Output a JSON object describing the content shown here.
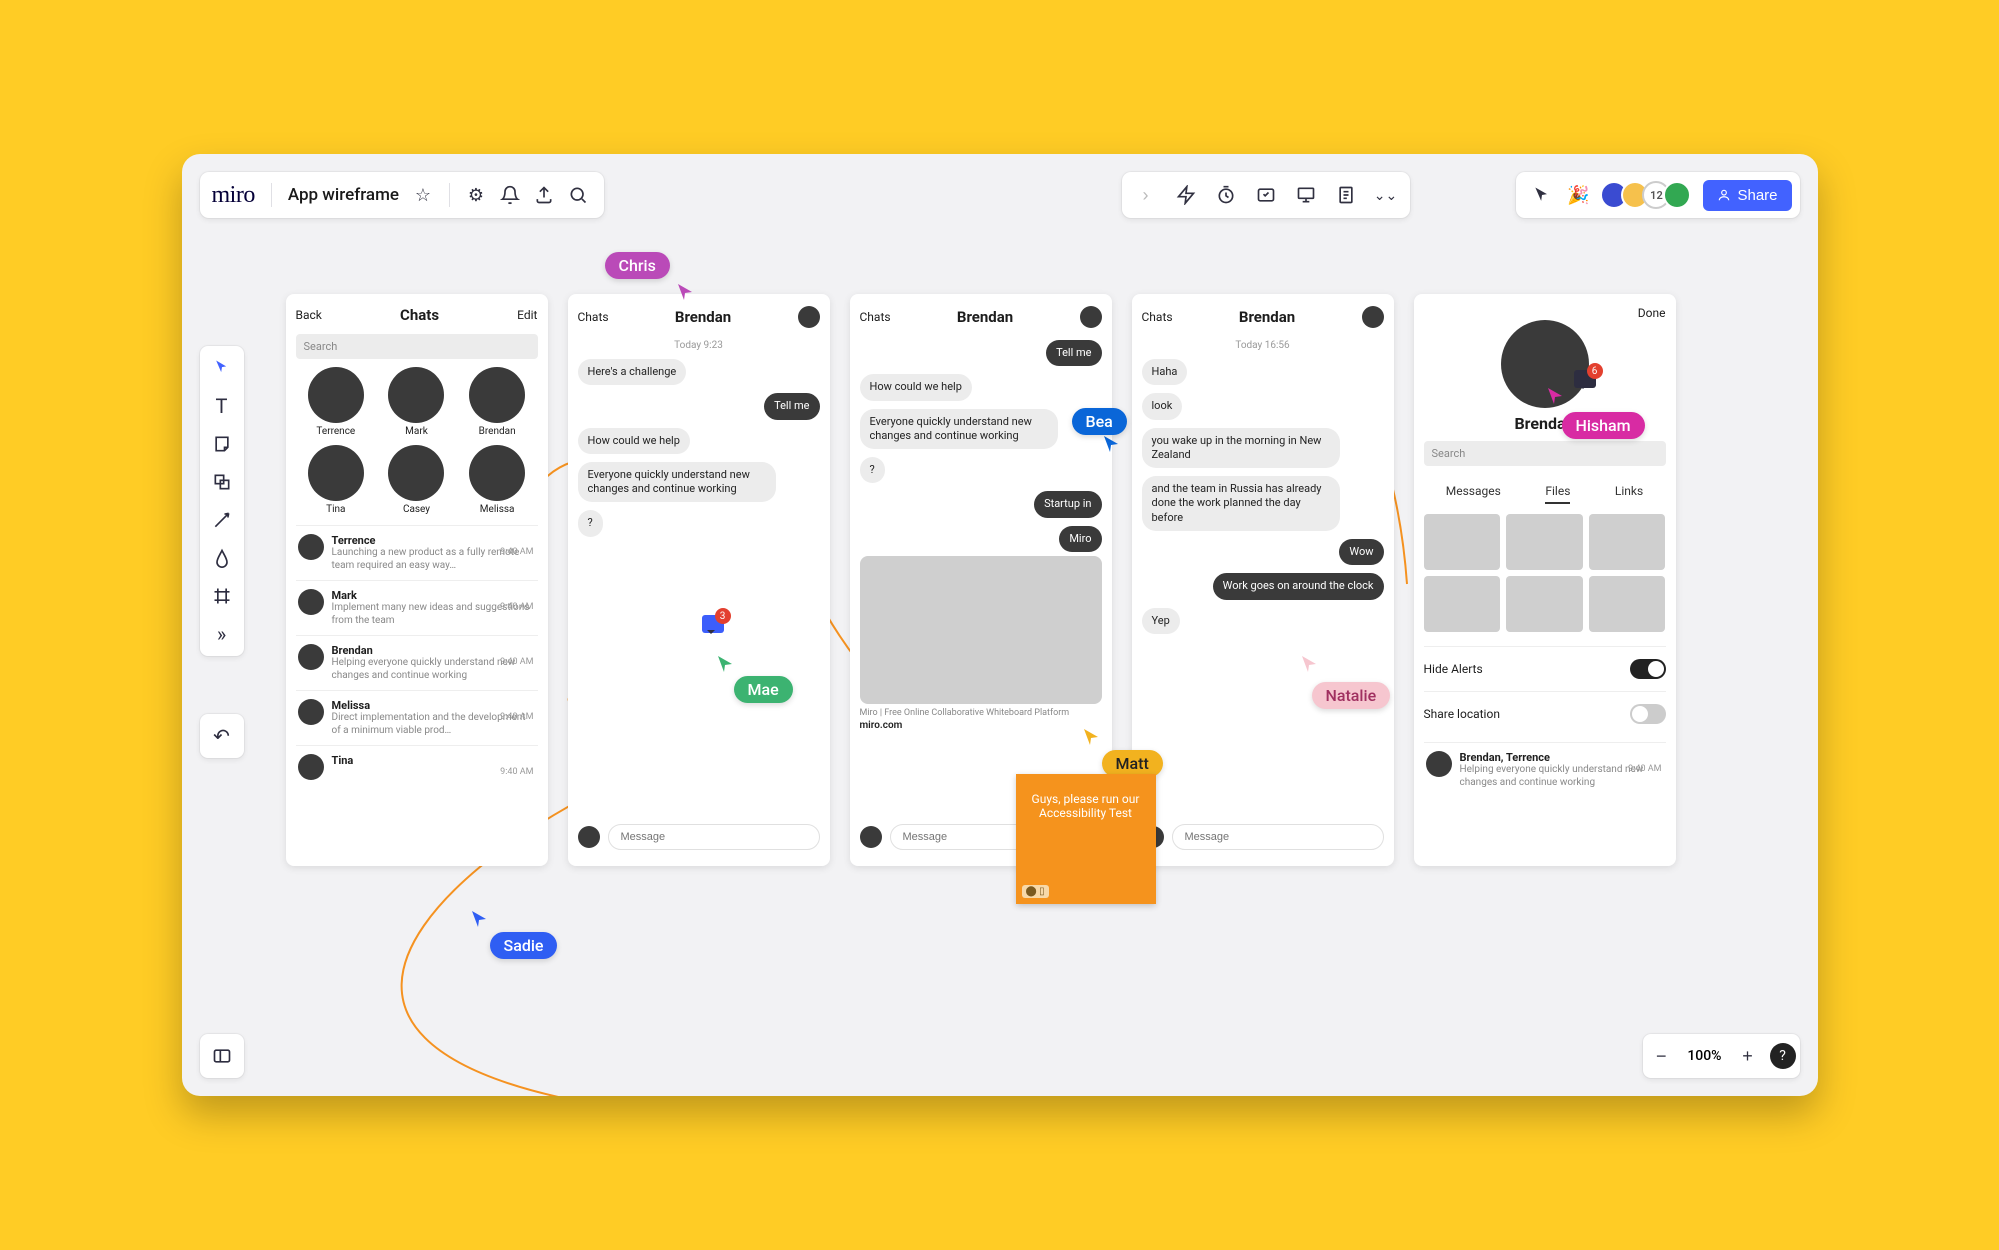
{
  "app": {
    "logo": "miro",
    "board_title": "App wireframe"
  },
  "share": {
    "label": "Share"
  },
  "avatar_count": "12",
  "zoom": {
    "level": "100%"
  },
  "cursors": {
    "chris": "Chris",
    "mae": "Mae",
    "sadie": "Sadie",
    "bea": "Bea",
    "matt": "Matt",
    "natalie": "Natalie",
    "hisham": "Hisham"
  },
  "sticky": {
    "text": "Guys, please run our Accessibility Test"
  },
  "chat_badge": {
    "count": "3"
  },
  "profile_badge": {
    "count": "6"
  },
  "times": {
    "t1": "Today 9:23",
    "t2": "Today 16:56"
  },
  "wf1": {
    "back": "Back",
    "title": "Chats",
    "edit": "Edit",
    "search": "Search",
    "contacts": [
      {
        "name": "Terrence"
      },
      {
        "name": "Mark"
      },
      {
        "name": "Brendan"
      },
      {
        "name": "Tina"
      },
      {
        "name": "Casey"
      },
      {
        "name": "Melissa"
      }
    ],
    "items": [
      {
        "name": "Terrence",
        "time": "9:40 AM",
        "preview": "Launching a new product as a fully remote team required an easy way…"
      },
      {
        "name": "Mark",
        "time": "9:40 AM",
        "preview": "Implement many new ideas and suggestions from the team"
      },
      {
        "name": "Brendan",
        "time": "9:40 AM",
        "preview": "Helping everyone quickly understand new changes and continue working"
      },
      {
        "name": "Melissa",
        "time": "9:40 AM",
        "preview": "Direct implementation and the development of a minimum viable prod…"
      },
      {
        "name": "Tina",
        "time": "9:40 AM",
        "preview": ""
      }
    ]
  },
  "wf2": {
    "back": "Chats",
    "title": "Brendan",
    "m1": "Here's a challenge",
    "r1": "Tell me",
    "m2": "How could we help",
    "m3": "Everyone quickly understand new changes and continue working",
    "m4": "?",
    "compose": "Message"
  },
  "wf3": {
    "back": "Chats",
    "title": "Brendan",
    "r0": "Tell me",
    "m1": "How could we help",
    "m2": "Everyone quickly understand new changes and continue working",
    "m3": "?",
    "r1": "Startup in",
    "r2": "Miro",
    "link_title": "Miro | Free Online Collaborative Whiteboard Platform",
    "link_url": "miro.com",
    "compose": "Message"
  },
  "wf4": {
    "back": "Chats",
    "title": "Brendan",
    "m1": "Haha",
    "m2": "look",
    "m3": "you wake up in the morning in New Zealand",
    "m4": "and the team in Russia has already done the work planned the day before",
    "r1": "Wow",
    "r2": "Work goes on around the clock",
    "m5": "Yep",
    "compose": "Message"
  },
  "wf5": {
    "done": "Done",
    "name": "Brendan",
    "search": "Search",
    "tabs": {
      "messages": "Messages",
      "files": "Files",
      "links": "Links"
    },
    "hide_alerts": "Hide Alerts",
    "share_loc": "Share location",
    "group_name": "Brendan, Terrence",
    "group_time": "9:40 AM",
    "group_preview": "Helping everyone quickly understand new changes and continue working"
  }
}
